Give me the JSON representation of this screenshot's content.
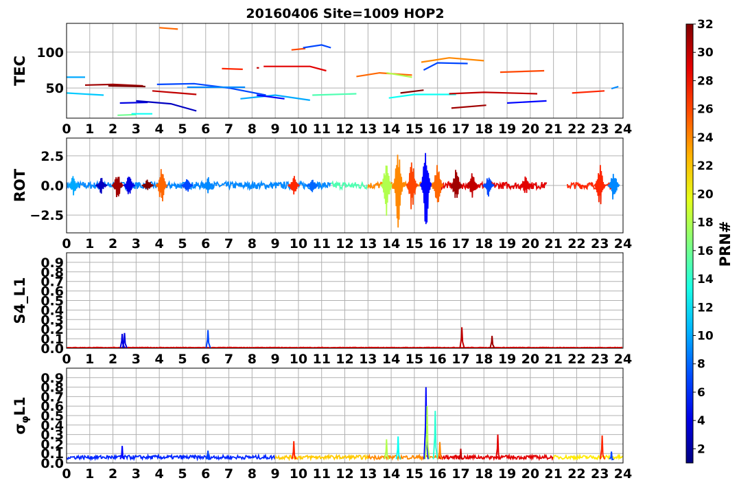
{
  "chart_data": {
    "title": "20160406 Site=1009 HOP2",
    "type": "line",
    "xlim": [
      0,
      24
    ],
    "x_ticks": [
      "0",
      "1",
      "2",
      "3",
      "4",
      "5",
      "6",
      "7",
      "8",
      "9",
      "10",
      "11",
      "12",
      "13",
      "14",
      "15",
      "16",
      "17",
      "18",
      "19",
      "20",
      "21",
      "22",
      "23",
      "24"
    ],
    "grid": true,
    "colorbar": {
      "label": "PRN#",
      "range": [
        1,
        32
      ],
      "ticks": [
        "2",
        "4",
        "6",
        "8",
        "10",
        "12",
        "14",
        "16",
        "18",
        "20",
        "22",
        "24",
        "26",
        "28",
        "30",
        "32"
      ],
      "colormap": "jet"
    },
    "panels": [
      {
        "ylabel": "TEC",
        "ylim": [
          8,
          140
        ],
        "y_ticks": [
          {
            "v": 50,
            "label": "50"
          },
          {
            "v": 100,
            "label": "100"
          }
        ],
        "series": [
          {
            "prn": 10,
            "x": [
              0.0,
              0.8
            ],
            "y": [
              65,
              65
            ]
          },
          {
            "prn": 11,
            "x": [
              0.0,
              1.6
            ],
            "y": [
              43,
              40
            ]
          },
          {
            "prn": 31,
            "x": [
              0.8,
              2.0,
              3.3
            ],
            "y": [
              54,
              55,
              53
            ]
          },
          {
            "prn": 32,
            "x": [
              1.8,
              3.4
            ],
            "y": [
              53,
              52
            ]
          },
          {
            "prn": 16,
            "x": [
              2.2,
              3.0
            ],
            "y": [
              12,
              13
            ]
          },
          {
            "prn": 13,
            "x": [
              2.8,
              3.7
            ],
            "y": [
              14,
              14
            ]
          },
          {
            "prn": 4,
            "x": [
              2.3,
              3.5
            ],
            "y": [
              29,
              30
            ]
          },
          {
            "prn": 3,
            "x": [
              3.0,
              4.5,
              5.6
            ],
            "y": [
              32,
              28,
              18
            ]
          },
          {
            "prn": 25,
            "x": [
              4.0,
              4.8
            ],
            "y": [
              134,
              132
            ]
          },
          {
            "prn": 30,
            "x": [
              3.7,
              5.6
            ],
            "y": [
              46,
              41
            ]
          },
          {
            "prn": 7,
            "x": [
              3.9,
              5.5,
              7.0,
              8.6
            ],
            "y": [
              55,
              56,
              50,
              40
            ]
          },
          {
            "prn": 9,
            "x": [
              5.2,
              7.0,
              7.7
            ],
            "y": [
              51,
              51,
              51
            ]
          },
          {
            "prn": 27,
            "x": [
              6.7,
              7.6
            ],
            "y": [
              77,
              76
            ]
          },
          {
            "prn": 30,
            "x": [
              8.2,
              8.3
            ],
            "y": [
              78,
              78
            ]
          },
          {
            "prn": 29,
            "x": [
              8.5,
              10.5,
              11.2
            ],
            "y": [
              80,
              80,
              74
            ]
          },
          {
            "prn": 10,
            "x": [
              7.5,
              9.0,
              10.5
            ],
            "y": [
              35,
              40,
              33
            ]
          },
          {
            "prn": 5,
            "x": [
              8.2,
              9.4
            ],
            "y": [
              40,
              35
            ]
          },
          {
            "prn": 26,
            "x": [
              9.7,
              10.3
            ],
            "y": [
              103,
              105
            ]
          },
          {
            "prn": 7,
            "x": [
              10.2,
              11.0,
              11.4
            ],
            "y": [
              106,
              110,
              106
            ]
          },
          {
            "prn": 15,
            "x": [
              10.6,
              12.5
            ],
            "y": [
              40,
              42
            ]
          },
          {
            "prn": 25,
            "x": [
              12.5,
              13.5,
              14.9
            ],
            "y": [
              66,
              71,
              68
            ]
          },
          {
            "prn": 18,
            "x": [
              13.8,
              14.9
            ],
            "y": [
              71,
              65
            ]
          },
          {
            "prn": 32,
            "x": [
              14.4,
              15.4
            ],
            "y": [
              43,
              47
            ]
          },
          {
            "prn": 13,
            "x": [
              13.9,
              15.0,
              16.8
            ],
            "y": [
              36,
              41,
              41
            ]
          },
          {
            "prn": 24,
            "x": [
              15.3,
              16.5,
              18.0
            ],
            "y": [
              86,
              92,
              88
            ]
          },
          {
            "prn": 7,
            "x": [
              15.4,
              16.0,
              17.3
            ],
            "y": [
              75,
              85,
              84
            ]
          },
          {
            "prn": 30,
            "x": [
              16.5,
              18.0,
              20.3
            ],
            "y": [
              42,
              44,
              42
            ]
          },
          {
            "prn": 31,
            "x": [
              16.6,
              18.1
            ],
            "y": [
              22,
              26
            ]
          },
          {
            "prn": 26,
            "x": [
              18.7,
              20.6
            ],
            "y": [
              72,
              74
            ]
          },
          {
            "prn": 5,
            "x": [
              19.0,
              20.7
            ],
            "y": [
              29,
              32
            ]
          },
          {
            "prn": 27,
            "x": [
              21.8,
              23.2
            ],
            "y": [
              43,
              46
            ]
          },
          {
            "prn": 9,
            "x": [
              23.5,
              23.8
            ],
            "y": [
              49,
              52
            ]
          }
        ]
      },
      {
        "ylabel": "ROT",
        "ylim": [
          -4,
          4
        ],
        "y_ticks": [
          {
            "v": 2.5,
            "label": "2.5"
          },
          {
            "v": 0,
            "label": "0.0"
          },
          {
            "v": -2.5,
            "label": "−2.5"
          }
        ],
        "events": [
          {
            "x": 0.3,
            "a": 0.9,
            "prn": 10
          },
          {
            "x": 1.5,
            "a": 0.7,
            "prn": 3
          },
          {
            "x": 2.2,
            "a": 1.2,
            "prn": 31
          },
          {
            "x": 2.7,
            "a": 0.9,
            "prn": 4
          },
          {
            "x": 3.5,
            "a": 0.6,
            "prn": 32
          },
          {
            "x": 4.1,
            "a": 1.6,
            "prn": 25
          },
          {
            "x": 5.2,
            "a": 0.6,
            "prn": 7
          },
          {
            "x": 6.1,
            "a": 0.8,
            "prn": 9
          },
          {
            "x": 9.8,
            "a": 0.9,
            "prn": 27
          },
          {
            "x": 10.6,
            "a": 0.7,
            "prn": 8
          },
          {
            "x": 13.8,
            "a": 2.6,
            "prn": 18
          },
          {
            "x": 14.3,
            "a": 3.6,
            "prn": 24
          },
          {
            "x": 14.9,
            "a": 2.5,
            "prn": 26
          },
          {
            "x": 15.5,
            "a": 3.6,
            "prn": 5
          },
          {
            "x": 16.0,
            "a": 2.0,
            "prn": 25
          },
          {
            "x": 16.8,
            "a": 1.8,
            "prn": 31
          },
          {
            "x": 17.5,
            "a": 1.2,
            "prn": 30
          },
          {
            "x": 18.2,
            "a": 1.0,
            "prn": 7
          },
          {
            "x": 19.8,
            "a": 0.8,
            "prn": 29
          },
          {
            "x": 23.0,
            "a": 1.8,
            "prn": 27
          },
          {
            "x": 23.6,
            "a": 1.5,
            "prn": 9
          }
        ]
      },
      {
        "ylabel": "S4_L1",
        "ylim": [
          0,
          1
        ],
        "y_ticks": [
          {
            "v": 0,
            "label": "0.0"
          },
          {
            "v": 0.1,
            "label": "0.1"
          },
          {
            "v": 0.2,
            "label": "0.2"
          },
          {
            "v": 0.3,
            "label": "0.3"
          },
          {
            "v": 0.4,
            "label": "0.4"
          },
          {
            "v": 0.5,
            "label": "0.5"
          },
          {
            "v": 0.6,
            "label": "0.6"
          },
          {
            "v": 0.7,
            "label": "0.7"
          },
          {
            "v": 0.8,
            "label": "0.8"
          },
          {
            "v": 0.9,
            "label": "0.9"
          }
        ],
        "spikes": [
          {
            "x": 2.4,
            "v": 0.15,
            "prn": 4
          },
          {
            "x": 2.5,
            "v": 0.16,
            "prn": 4
          },
          {
            "x": 6.1,
            "v": 0.19,
            "prn": 7
          },
          {
            "x": 17.05,
            "v": 0.22,
            "prn": 30
          },
          {
            "x": 18.35,
            "v": 0.13,
            "prn": 31
          }
        ]
      },
      {
        "ylabel": "σφL1",
        "ylim": [
          0,
          1
        ],
        "y_ticks": [
          {
            "v": 0,
            "label": "0.0"
          },
          {
            "v": 0.1,
            "label": "0.1"
          },
          {
            "v": 0.2,
            "label": "0.2"
          },
          {
            "v": 0.3,
            "label": "0.3"
          },
          {
            "v": 0.4,
            "label": "0.4"
          },
          {
            "v": 0.5,
            "label": "0.5"
          },
          {
            "v": 0.6,
            "label": "0.6"
          },
          {
            "v": 0.7,
            "label": "0.7"
          },
          {
            "v": 0.8,
            "label": "0.8"
          },
          {
            "v": 0.9,
            "label": "0.9"
          }
        ],
        "spikes": [
          {
            "x": 2.4,
            "v": 0.18,
            "prn": 5
          },
          {
            "x": 6.1,
            "v": 0.13,
            "prn": 7
          },
          {
            "x": 9.8,
            "v": 0.23,
            "prn": 27
          },
          {
            "x": 13.8,
            "v": 0.25,
            "prn": 18
          },
          {
            "x": 14.3,
            "v": 0.28,
            "prn": 13
          },
          {
            "x": 15.5,
            "v": 0.8,
            "prn": 5
          },
          {
            "x": 15.55,
            "v": 0.6,
            "prn": 18
          },
          {
            "x": 15.9,
            "v": 0.55,
            "prn": 14
          },
          {
            "x": 16.1,
            "v": 0.22,
            "prn": 24
          },
          {
            "x": 17.0,
            "v": 0.15,
            "prn": 30
          },
          {
            "x": 18.6,
            "v": 0.3,
            "prn": 29
          },
          {
            "x": 23.1,
            "v": 0.29,
            "prn": 27
          },
          {
            "x": 23.5,
            "v": 0.12,
            "prn": 7
          }
        ]
      }
    ]
  }
}
